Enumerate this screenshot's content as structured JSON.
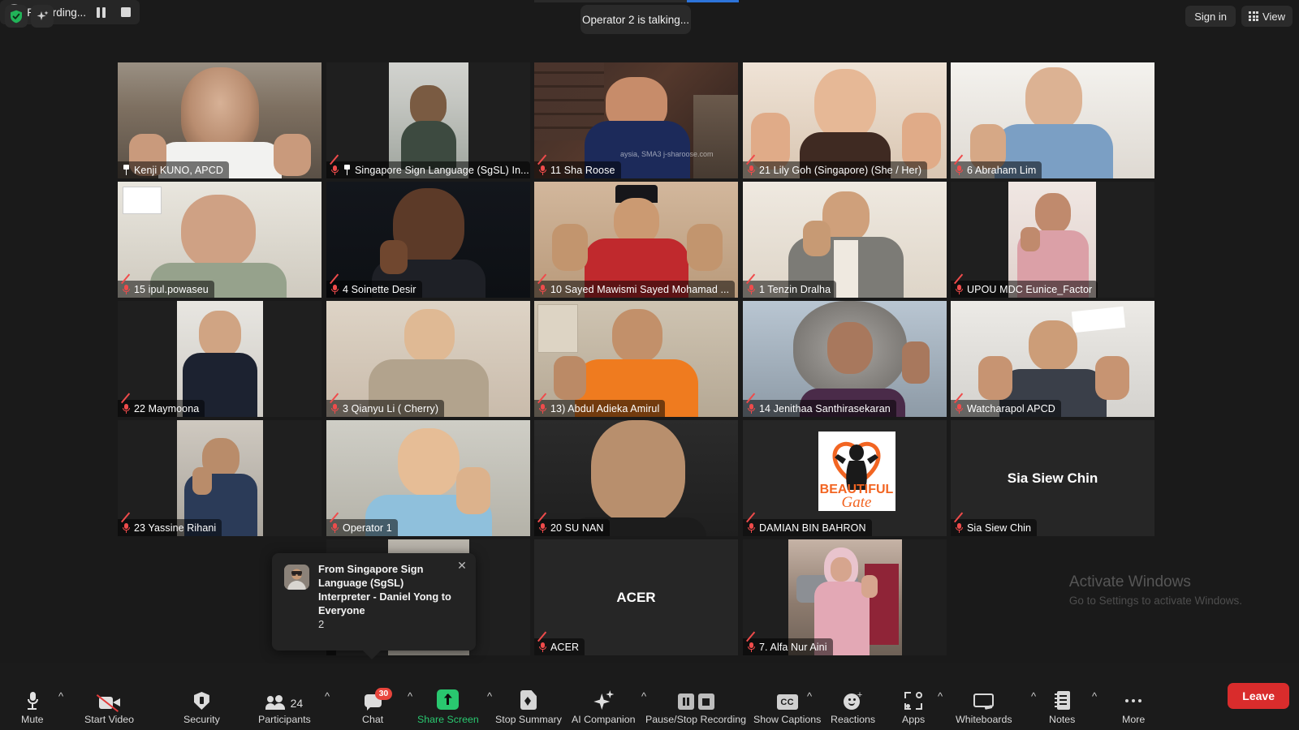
{
  "topbar": {
    "shield_icon": "shield-check-icon",
    "spark_icon": "ai-sparkle-icon",
    "recording_label": "Recording...",
    "pause_icon": "pause-icon",
    "stop_icon": "stop-icon",
    "talking_banner": "Operator 2 is talking...",
    "signin_label": "Sign in",
    "view_label": "View",
    "view_icon": "grid-view-icon"
  },
  "gallery": {
    "tiles": [
      {
        "name": "Kenji KUNO, APCD",
        "muted": false,
        "pinned": true,
        "type": "video"
      },
      {
        "name": "Singapore Sign Language (SgSL) In...",
        "muted": true,
        "pinned": true,
        "type": "video"
      },
      {
        "name": "11 Sha Roose",
        "overlay_text": "aysia, SMA3 j-sharoose.com",
        "muted": true,
        "pinned": false,
        "type": "video"
      },
      {
        "name": "21 Lily Goh (Singapore) (She / Her)",
        "muted": true,
        "pinned": false,
        "type": "video"
      },
      {
        "name": "6 Abraham Lim",
        "muted": true,
        "pinned": false,
        "type": "video"
      },
      {
        "name": "15 ipul.powaseu",
        "muted": true,
        "pinned": false,
        "type": "video"
      },
      {
        "name": "4 Soinette Desir",
        "muted": true,
        "pinned": false,
        "type": "video"
      },
      {
        "name": "10 Sayed Mawismi Sayed Mohamad ...",
        "muted": true,
        "pinned": false,
        "type": "video"
      },
      {
        "name": "1 Tenzin Dralha",
        "muted": true,
        "pinned": false,
        "type": "video"
      },
      {
        "name": "UPOU MDC Eunice_Factor",
        "muted": true,
        "pinned": false,
        "type": "video"
      },
      {
        "name": "22 Maymoona",
        "muted": true,
        "pinned": false,
        "type": "video"
      },
      {
        "name": "3 Qianyu Li ( Cherry)",
        "muted": true,
        "pinned": false,
        "type": "video"
      },
      {
        "name": "13) Abdul Adieka Amirul",
        "muted": true,
        "pinned": false,
        "type": "video"
      },
      {
        "name": "14 Jenithaa Santhirasekaran",
        "muted": true,
        "pinned": false,
        "type": "video"
      },
      {
        "name": "Watcharapol APCD",
        "muted": true,
        "pinned": false,
        "type": "video"
      },
      {
        "name": "23 Yassine Rihani",
        "muted": true,
        "pinned": false,
        "type": "video"
      },
      {
        "name": "Operator 1",
        "muted": true,
        "pinned": false,
        "type": "video"
      },
      {
        "name": "20 SU NAN",
        "muted": true,
        "pinned": false,
        "type": "video"
      },
      {
        "name": "DAMIAN BIN BAHRON",
        "muted": true,
        "pinned": false,
        "type": "avatar",
        "avatar_text": "BEAUTIFUL Gate"
      },
      {
        "name": "Sia Siew Chin",
        "muted": true,
        "pinned": false,
        "type": "placeholder",
        "placeholder_text": "Sia Siew Chin"
      },
      {
        "name": "",
        "muted": false,
        "pinned": false,
        "type": "video"
      },
      {
        "name": "ACER",
        "muted": true,
        "pinned": false,
        "type": "placeholder",
        "placeholder_text": "ACER"
      },
      {
        "name": "7. Alfa Nur Aini",
        "muted": true,
        "pinned": false,
        "type": "video"
      }
    ]
  },
  "toast": {
    "header": "From Singapore Sign Language (SgSL) Interpreter - Daniel Yong to Everyone",
    "message": "2",
    "close_icon": "close-icon",
    "avatar": "participant-avatar"
  },
  "watermark": {
    "title": "Activate Windows",
    "subtitle": "Go to Settings to activate Windows."
  },
  "toolbar": {
    "items": [
      {
        "label": "Mute",
        "icon": "microphone-icon",
        "caret": true,
        "badge": null,
        "accent": "#d9d9d9"
      },
      {
        "label": "Start Video",
        "icon": "camera-off-icon",
        "caret": false,
        "badge": null,
        "accent": "#d9d9d9"
      },
      {
        "label": "Security",
        "icon": "shield-icon",
        "caret": false,
        "badge": null,
        "accent": "#d9d9d9"
      },
      {
        "label": "Participants",
        "icon": "people-icon",
        "caret": true,
        "badge": "24",
        "accent": "#d9d9d9"
      },
      {
        "label": "Chat",
        "icon": "chat-bubble-icon",
        "caret": true,
        "badge": "30",
        "accent": "#d9d9d9"
      },
      {
        "label": "Share Screen",
        "icon": "share-screen-icon",
        "caret": true,
        "badge": null,
        "accent": "#29c76f"
      },
      {
        "label": "Stop Summary",
        "icon": "summary-doc-icon",
        "caret": false,
        "badge": null,
        "accent": "#d9d9d9"
      },
      {
        "label": "AI Companion",
        "icon": "ai-sparkle-icon",
        "caret": true,
        "badge": null,
        "accent": "#d9d9d9"
      },
      {
        "label": "Pause/Stop Recording",
        "icon": "pause-stop-recording-icon",
        "caret": false,
        "badge": null,
        "accent": "#d9d9d9"
      },
      {
        "label": "Show Captions",
        "icon": "closed-caption-icon",
        "caret": true,
        "badge": null,
        "accent": "#d9d9d9"
      },
      {
        "label": "Reactions",
        "icon": "reactions-icon",
        "caret": false,
        "badge": null,
        "accent": "#d9d9d9"
      },
      {
        "label": "Apps",
        "icon": "apps-icon",
        "caret": true,
        "badge": null,
        "accent": "#d9d9d9"
      },
      {
        "label": "Whiteboards",
        "icon": "whiteboard-icon",
        "caret": true,
        "badge": null,
        "accent": "#d9d9d9"
      },
      {
        "label": "Notes",
        "icon": "notes-icon",
        "caret": true,
        "badge": null,
        "accent": "#d9d9d9"
      },
      {
        "label": "More",
        "icon": "more-dots-icon",
        "caret": false,
        "badge": null,
        "accent": "#d9d9d9"
      }
    ],
    "leave_label": "Leave"
  },
  "colors": {
    "background": "#1a1a1a",
    "toolbar_bg": "#1b1b1b",
    "accent_green": "#29c76f",
    "badge_red": "#e8453c",
    "leave_red": "#d92c2c",
    "mute_slash": "#ef4b4b",
    "talking_blue": "#2d74da"
  }
}
